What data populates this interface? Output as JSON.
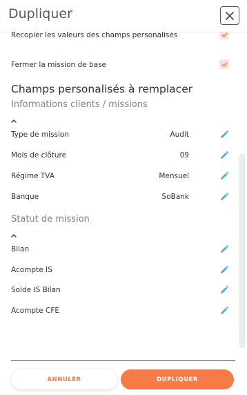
{
  "dialog": {
    "title": "Dupliquer"
  },
  "options": [
    {
      "label": "Recopier les valeurs des champs personalisés",
      "checked": true
    },
    {
      "label": "Fermer la mission de base",
      "checked": true
    }
  ],
  "section_title": "Champs personalisés à remplacer",
  "groups": [
    {
      "title": "Informations clients / missions",
      "fields": [
        {
          "label": "Type de mission",
          "value": "Audit"
        },
        {
          "label": "Mois de clôture",
          "value": "09"
        },
        {
          "label": "Régime TVA",
          "value": "Mensuel"
        },
        {
          "label": "Banque",
          "value": "SoBank"
        }
      ]
    },
    {
      "title": "Statut de mission",
      "fields": [
        {
          "label": "Bilan",
          "value": ""
        },
        {
          "label": "Acompte IS",
          "value": ""
        },
        {
          "label": "Solde IS Bilan",
          "value": ""
        },
        {
          "label": "Acompte CFE",
          "value": ""
        }
      ]
    }
  ],
  "footer": {
    "cancel_label": "ANNULER",
    "confirm_label": "DUPLIQUER"
  },
  "colors": {
    "accent": "#f77a47",
    "checkbox_bg": "#fbe1d7",
    "edit_icon": "#4fa8e8"
  },
  "icons": {
    "close": "close-icon",
    "edit": "pencil-icon",
    "caret": "chevron-up-icon",
    "check": "check-icon"
  }
}
